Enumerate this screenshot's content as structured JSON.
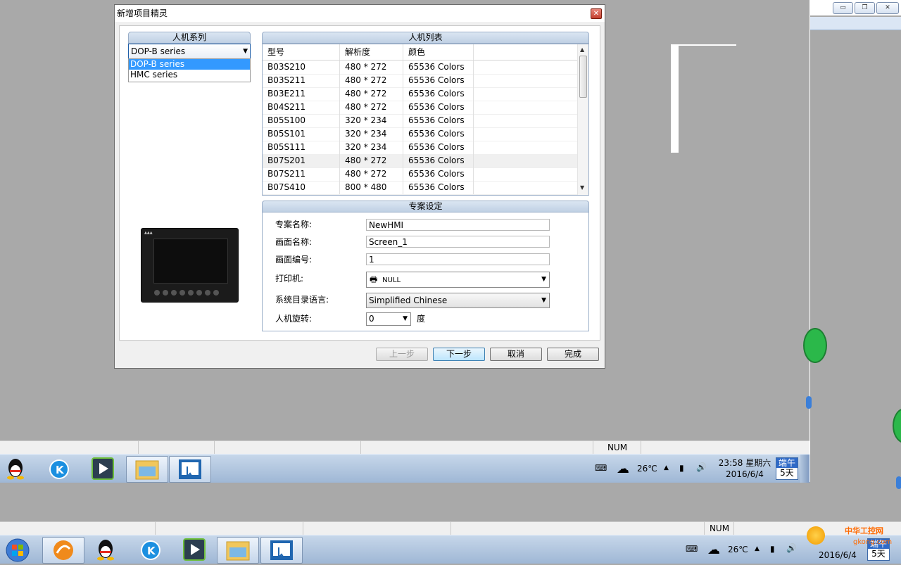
{
  "dialog": {
    "title": "新增项目精灵",
    "series_group": {
      "header": "人机系列",
      "selected": "DOP-B series",
      "options": [
        "DOP-B series",
        "HMC series"
      ]
    },
    "list_group": {
      "header": "人机列表",
      "columns": [
        "型号",
        "解析度",
        "颜色"
      ],
      "rows": [
        [
          "B03S210",
          "480 * 272",
          "65536 Colors"
        ],
        [
          "B03S211",
          "480 * 272",
          "65536 Colors"
        ],
        [
          "B03E211",
          "480 * 272",
          "65536 Colors"
        ],
        [
          "B04S211",
          "480 * 272",
          "65536 Colors"
        ],
        [
          "B05S100",
          "320 * 234",
          "65536 Colors"
        ],
        [
          "B05S101",
          "320 * 234",
          "65536 Colors"
        ],
        [
          "B05S111",
          "320 * 234",
          "65536 Colors"
        ],
        [
          "B07S201",
          "480 * 272",
          "65536 Colors"
        ],
        [
          "B07S211",
          "480 * 272",
          "65536 Colors"
        ],
        [
          "B07S410",
          "800 * 480",
          "65536 Colors"
        ]
      ]
    },
    "settings": {
      "header": "专案设定",
      "project_name_label": "专案名称:",
      "project_name": "NewHMI",
      "screen_name_label": "画面名称:",
      "screen_name": "Screen_1",
      "screen_no_label": "画面编号:",
      "screen_no": "1",
      "printer_label": "打印机:",
      "printer": "NULL",
      "language_label": "系统目录语言:",
      "language": "Simplified Chinese",
      "rotation_label": "人机旋转:",
      "rotation": "0",
      "rotation_unit": "度"
    },
    "buttons": {
      "prev": "上一步",
      "next": "下一步",
      "cancel": "取消",
      "finish": "完成"
    }
  },
  "statusbar": {
    "num": "NUM"
  },
  "taskbar": {
    "weather_temp": "26℃",
    "time": "23:58 星期六",
    "date": "2016/6/4",
    "cal_top": "端午",
    "cal_bottom": "5天"
  },
  "taskbar_bottom": {
    "num": "NUM",
    "weather_temp": "26℃",
    "date": "2016/6/4",
    "cal_top": "端午",
    "cal_bottom": "5天"
  },
  "watermark": {
    "text": "中华工控网",
    "url": "gkong.com"
  }
}
